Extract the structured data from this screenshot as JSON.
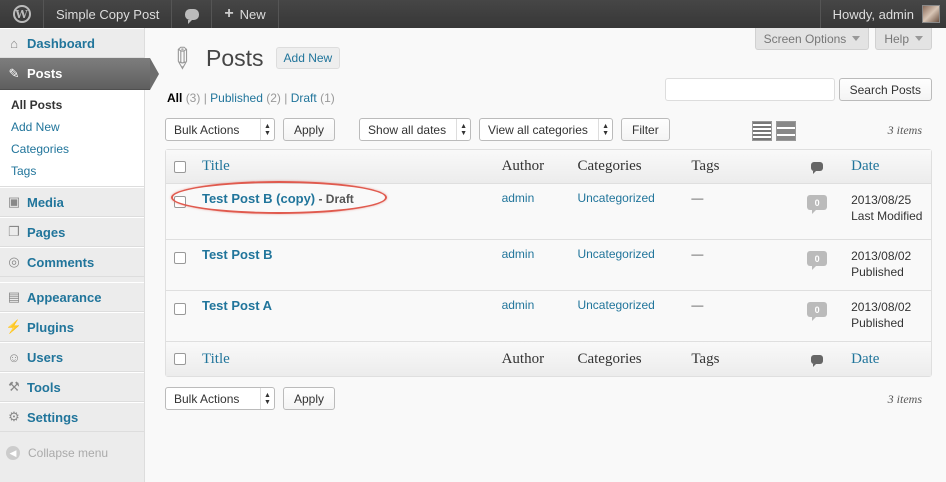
{
  "adminbar": {
    "site_name": "Simple Copy Post",
    "new_label": "New",
    "howdy": "Howdy, admin"
  },
  "sidebar": {
    "items": [
      {
        "label": "Dashboard",
        "icon": "dashboard-icon"
      },
      {
        "label": "Posts",
        "icon": "pin-icon"
      },
      {
        "label": "Media",
        "icon": "media-icon"
      },
      {
        "label": "Pages",
        "icon": "pages-icon"
      },
      {
        "label": "Comments",
        "icon": "comments-icon"
      },
      {
        "label": "Appearance",
        "icon": "appearance-icon"
      },
      {
        "label": "Plugins",
        "icon": "plugins-icon"
      },
      {
        "label": "Users",
        "icon": "users-icon"
      },
      {
        "label": "Tools",
        "icon": "tools-icon"
      },
      {
        "label": "Settings",
        "icon": "settings-icon"
      }
    ],
    "submenu": [
      "All Posts",
      "Add New",
      "Categories",
      "Tags"
    ],
    "collapse": "Collapse menu"
  },
  "screen_options": "Screen Options",
  "help": "Help",
  "page": {
    "title": "Posts",
    "add_new": "Add New"
  },
  "filters": {
    "all": "All",
    "all_count": "(3)",
    "published": "Published",
    "published_count": "(2)",
    "draft": "Draft",
    "draft_count": "(1)",
    "sep": "|"
  },
  "search": {
    "placeholder": "",
    "button": "Search Posts"
  },
  "tablenav": {
    "bulk_actions": "Bulk Actions",
    "apply": "Apply",
    "dates": "Show all dates",
    "categories": "View all categories",
    "filter": "Filter",
    "items": "3 items"
  },
  "columns": {
    "title": "Title",
    "author": "Author",
    "categories": "Categories",
    "tags": "Tags",
    "date": "Date"
  },
  "posts": [
    {
      "title": "Test Post B (copy)",
      "state": " - Draft",
      "author": "admin",
      "category": "Uncategorized",
      "tags": "—",
      "comments": "0",
      "date": "2013/08/25",
      "status": "Last Modified"
    },
    {
      "title": "Test Post B",
      "state": "",
      "author": "admin",
      "category": "Uncategorized",
      "tags": "—",
      "comments": "0",
      "date": "2013/08/02",
      "status": "Published"
    },
    {
      "title": "Test Post A",
      "state": "",
      "author": "admin",
      "category": "Uncategorized",
      "tags": "—",
      "comments": "0",
      "date": "2013/08/02",
      "status": "Published"
    }
  ],
  "colors": {
    "link": "#21759b",
    "highlight_ring": "#e05a4e",
    "current_menu": "#6e6e6e"
  }
}
